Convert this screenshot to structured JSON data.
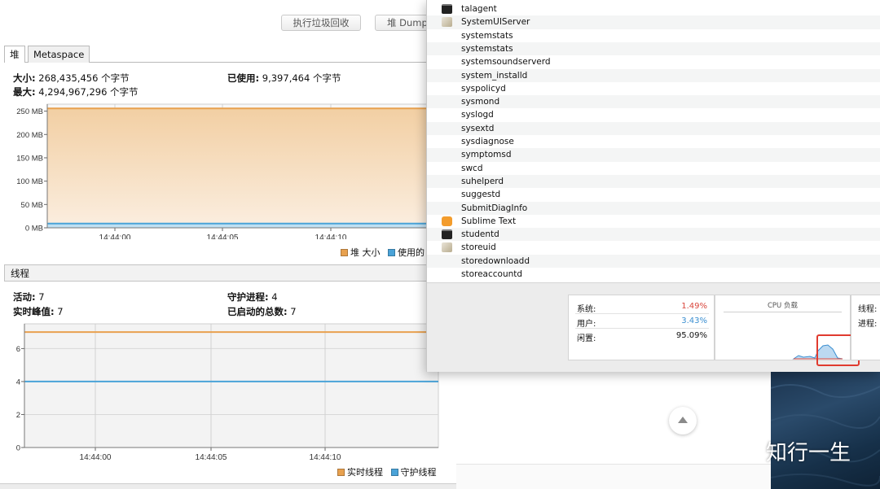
{
  "toolbar": {
    "gc_button": "执行垃圾回收",
    "dump_button": "堆 Dump"
  },
  "heap": {
    "tabs": [
      "堆",
      "Metaspace"
    ],
    "size_label": "大小:",
    "size_value": "268,435,456 个字节",
    "max_label": "最大:",
    "max_value": "4,294,967,296 个字节",
    "used_label": "已使用:",
    "used_value": "9,397,464 个字节",
    "legend": {
      "heap_size": "堆 大小",
      "used": "使用的"
    }
  },
  "threads": {
    "title": "线程",
    "live_label": "活动:",
    "live_value": "7",
    "peak_label": "实时峰值:",
    "peak_value": "7",
    "daemon_label": "守护进程:",
    "daemon_value": "4",
    "started_label": "已启动的总数:",
    "started_value": "7",
    "legend": {
      "live": "实时线程",
      "daemon": "守护线程"
    }
  },
  "chart_data": [
    {
      "type": "area",
      "title": "",
      "x_ticks": [
        "14:44:00",
        "14:44:05",
        "14:44:10"
      ],
      "y_ticks": [
        "0 MB",
        "50 MB",
        "100 MB",
        "150 MB",
        "200 MB",
        "250 MB"
      ],
      "ylim": [
        0,
        265
      ],
      "series": [
        {
          "name": "堆 大小",
          "values": [
            256,
            256,
            256,
            256
          ],
          "color": "#e8a14f"
        },
        {
          "name": "使用的",
          "values": [
            9,
            9,
            9,
            9
          ],
          "color": "#4aa3d8"
        }
      ],
      "grid": true,
      "legend": "bottom-right"
    },
    {
      "type": "line",
      "title": "",
      "x_ticks": [
        "14:44:00",
        "14:44:05",
        "14:44:10"
      ],
      "y_ticks": [
        "0",
        "2",
        "4",
        "6"
      ],
      "ylim": [
        0,
        7.5
      ],
      "series": [
        {
          "name": "实时线程",
          "values": [
            7,
            7,
            7,
            7
          ],
          "color": "#e8a14f"
        },
        {
          "name": "守护线程",
          "values": [
            4,
            4,
            4,
            4
          ],
          "color": "#4aa3d8"
        }
      ],
      "grid": true,
      "legend": "bottom-right"
    }
  ],
  "processes": [
    {
      "name": "talagent",
      "icon": "terminal-icon"
    },
    {
      "name": "SystemUIServer",
      "icon": "app-icon"
    },
    {
      "name": "systemstats",
      "icon": ""
    },
    {
      "name": "systemstats",
      "icon": ""
    },
    {
      "name": "systemsoundserverd",
      "icon": ""
    },
    {
      "name": "system_installd",
      "icon": ""
    },
    {
      "name": "syspolicyd",
      "icon": ""
    },
    {
      "name": "sysmond",
      "icon": ""
    },
    {
      "name": "syslogd",
      "icon": ""
    },
    {
      "name": "sysextd",
      "icon": ""
    },
    {
      "name": "sysdiagnose",
      "icon": ""
    },
    {
      "name": "symptomsd",
      "icon": ""
    },
    {
      "name": "swcd",
      "icon": ""
    },
    {
      "name": "suhelperd",
      "icon": ""
    },
    {
      "name": "suggestd",
      "icon": ""
    },
    {
      "name": "SubmitDiagInfo",
      "icon": ""
    },
    {
      "name": "Sublime Text",
      "icon": "sublime-icon"
    },
    {
      "name": "studentd",
      "icon": "terminal-icon"
    },
    {
      "name": "storeuid",
      "icon": "app-icon"
    },
    {
      "name": "storedownloadd",
      "icon": ""
    },
    {
      "name": "storeaccountd",
      "icon": ""
    }
  ],
  "cpu": {
    "system_label": "系统:",
    "system_value": "1.49%",
    "user_label": "用户:",
    "user_value": "3.43%",
    "idle_label": "闲置:",
    "idle_value": "95.09%",
    "load_title": "CPU 负载",
    "threads_label": "线程:",
    "processes_label": "进程:",
    "colors": {
      "system": "#d9463c",
      "user": "#3b8fd1"
    }
  },
  "watermark": {
    "text": "知行一生"
  }
}
